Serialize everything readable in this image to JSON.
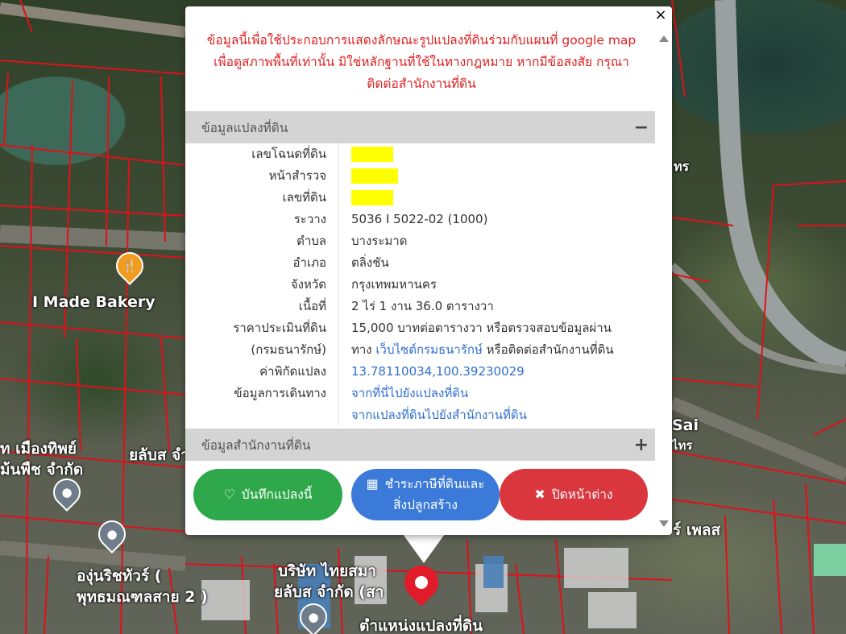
{
  "map": {
    "labels": {
      "bakery": "I Made Bakery",
      "company_left_1": "ท เมืองทิพย์",
      "company_left_2": "ยลับส จำกัด",
      "company_left_3": "ม้นพืช จำกัด",
      "tour_1": "องุ่นริชทัวร์ (",
      "tour_2": "พุทธมณฑลสาย 2 )",
      "company_bottom_1": "บริษัท ไทยสมา",
      "company_bottom_2": "ยลับส จำกัด (สา",
      "place_right_1": "ร์ เพลส",
      "place_right_2": "Sai",
      "place_right_3": "ไทร",
      "bottom_label": "ตำแหน่งแปลงที่ดิน",
      "top_right": "ทร"
    }
  },
  "popup": {
    "disclaimer": [
      "ข้อมูลนี้เพื่อใช้ประกอบการแสดงลักษณะรูปแปลงที่ดินร่วมกับแผนที่ google map",
      "เพื่อดูสภาพพื้นที่เท่านั้น มิใช่หลักฐานที่ใช้ในทางกฎหมาย หากมีข้อสงสัย กรุณา",
      "ติดต่อสำนักงานที่ดิน"
    ],
    "section1": {
      "title": "ข้อมูลแปลงที่ดิน",
      "toggle": "−"
    },
    "section2": {
      "title": "ข้อมูลสำนักงานที่ดิน",
      "toggle": "+"
    },
    "fields": {
      "deed_no": {
        "label": "เลขโฉนดที่ดิน"
      },
      "survey_page": {
        "label": "หน้าสำรวจ"
      },
      "land_no": {
        "label": "เลขที่ดิน"
      },
      "sheet": {
        "label": "ระวาง",
        "value": "5036 I 5022-02 (1000)"
      },
      "subdistrict": {
        "label": "ตำบล",
        "value": "บางระมาด"
      },
      "district": {
        "label": "อำเภอ",
        "value": "ตลิ่งชัน"
      },
      "province": {
        "label": "จังหวัด",
        "value": "กรุงเทพมหานคร"
      },
      "area": {
        "label": "เนื้อที่",
        "value": "2 ไร่ 1 งาน 36.0 ตารางวา"
      },
      "price": {
        "label1": "ราคาประเมินที่ดิน",
        "label2": "(กรมธนารักษ์)",
        "value1": "15,000 บาทต่อตารางวา หรือตรวจสอบข้อมูลผ่าน",
        "value2_pre": "ทาง",
        "value2_link": "เว็บไซต์กรมธนารักษ์",
        "value2_post": "หรือติดต่อสำนักงานที่ดิน"
      },
      "coords": {
        "label": "ค่าพิกัดแปลง",
        "value": "13.78110034,100.39230029"
      },
      "travel": {
        "label": "ข้อมูลการเดินทาง",
        "link1": "จากที่นี่ไปยังแปลงที่ดิน",
        "link2": "จากแปลงที่ดินไปยังสำนักงานที่ดิน"
      }
    },
    "buttons": {
      "save": "บันทึกแปลงนี้",
      "pay_line1": "ชำระภาษีที่ดินและ",
      "pay_line2": "สิ่งปลูกสร้าง",
      "close": "ปิดหน้าต่าง"
    },
    "close_glyph": "×"
  },
  "colors": {
    "green": "#2ea84a",
    "blue": "#3b7ad8",
    "red": "#d9363e",
    "highlight": "#ffff00",
    "parcel_line": "#e0101a"
  }
}
